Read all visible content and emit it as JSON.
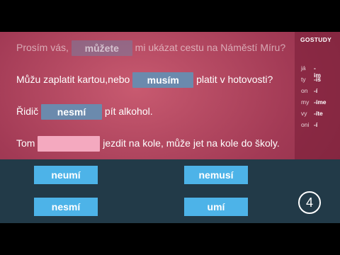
{
  "sentences": [
    {
      "before": "Prosím vás, ",
      "blank": "můžete",
      "after": " mi ukázat cestu na Náměstí Míru?"
    },
    {
      "before": "Můžu zaplatit kartou,nebo ",
      "blank": "musím",
      "after": " platit v hotovosti?"
    },
    {
      "before": "Řidič ",
      "blank": "nesmí",
      "after": " pít alkohol."
    },
    {
      "before": "Tom ",
      "blank": "",
      "after": " jezdit na kole, může jet na kole do školy."
    }
  ],
  "sidebar": {
    "logo": "GOSTUDY",
    "conjugation": [
      {
        "pronoun": "já",
        "ending": "-im"
      },
      {
        "pronoun": "ty",
        "ending": "-íš"
      },
      {
        "pronoun": "on",
        "ending": "-í"
      },
      {
        "pronoun": "my",
        "ending": "-íme"
      },
      {
        "pronoun": "vy",
        "ending": "-íte"
      },
      {
        "pronoun": "oni",
        "ending": "-í"
      }
    ]
  },
  "options": [
    "neumí",
    "nemusí",
    "nesmí",
    "umí"
  ],
  "page_number": "4",
  "colors": {
    "background": "#a23a55",
    "filled_blank": "#6b8aad",
    "empty_blank": "#f4a9bf",
    "answer_panel": "#223a48",
    "option_button": "#4db3e8"
  }
}
